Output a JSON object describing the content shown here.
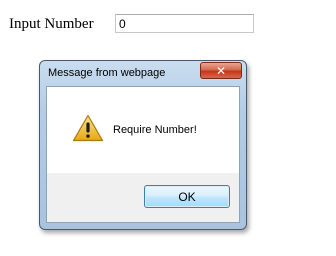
{
  "form": {
    "label": "Input Number",
    "input_value": "0"
  },
  "dialog": {
    "title": "Message from webpage",
    "close_glyph": "✕",
    "message": "Require Number!",
    "ok_label": "OK",
    "icon": "warning-icon"
  },
  "colors": {
    "titlebar": "#b4cce6",
    "close_button": "#c2371c",
    "ok_button_border": "#3c7fb1",
    "warning_yellow": "#f6c23b"
  }
}
